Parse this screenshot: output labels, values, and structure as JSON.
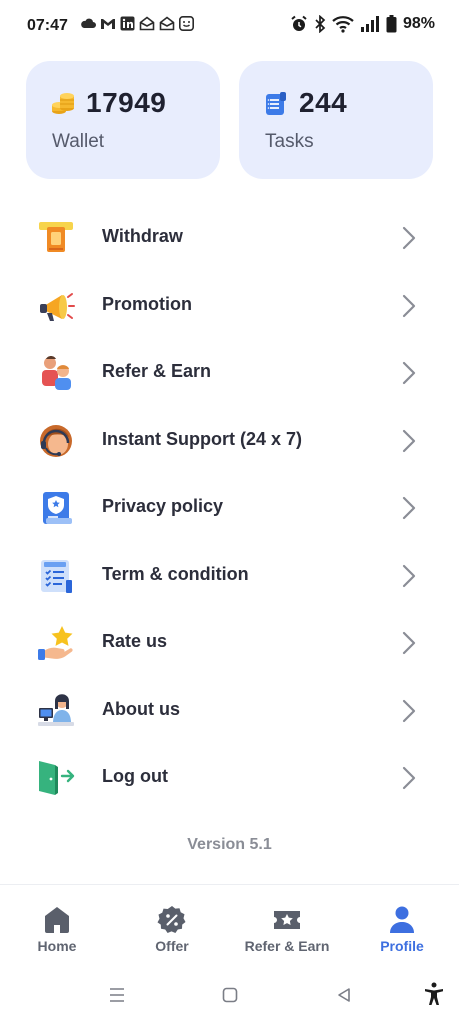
{
  "status_bar": {
    "time": "07:47",
    "battery": "98%",
    "notification_icons": [
      "cloud-icon",
      "gmail-icon",
      "linkedin-icon",
      "mail-open-icon",
      "mail-open-icon",
      "smiley-app-icon"
    ],
    "system_icons": [
      "alarm-icon",
      "bluetooth-icon",
      "wifi-icon",
      "signal-icon",
      "battery-icon"
    ]
  },
  "stats": {
    "wallet": {
      "value": "17949",
      "label": "Wallet",
      "icon": "coins-icon"
    },
    "tasks": {
      "value": "244",
      "label": "Tasks",
      "icon": "task-list-icon"
    }
  },
  "menu": {
    "items": [
      {
        "label": "Withdraw",
        "icon": "withdraw-icon"
      },
      {
        "label": "Promotion",
        "icon": "megaphone-icon"
      },
      {
        "label": "Refer & Earn",
        "icon": "people-icon"
      },
      {
        "label": "Instant Support (24 x 7)",
        "icon": "support-agent-icon"
      },
      {
        "label": "Privacy policy",
        "icon": "shield-document-icon"
      },
      {
        "label": "Term & condition",
        "icon": "checklist-icon"
      },
      {
        "label": "Rate us",
        "icon": "star-hand-icon"
      },
      {
        "label": "About us",
        "icon": "person-desk-icon"
      },
      {
        "label": "Log out",
        "icon": "door-exit-icon"
      }
    ]
  },
  "version": "Version 5.1",
  "bottom_nav": {
    "items": [
      {
        "label": "Home",
        "icon": "home-icon",
        "active": false
      },
      {
        "label": "Offer",
        "icon": "offer-badge-icon",
        "active": false
      },
      {
        "label": "Refer & Earn",
        "icon": "ticket-star-icon",
        "active": false
      },
      {
        "label": "Profile",
        "icon": "profile-icon",
        "active": true
      }
    ]
  },
  "colors": {
    "card_background": "#e8edfd",
    "accent": "#3d6fe0",
    "text_primary": "#2c2e3b",
    "text_muted": "#8a8d96"
  }
}
